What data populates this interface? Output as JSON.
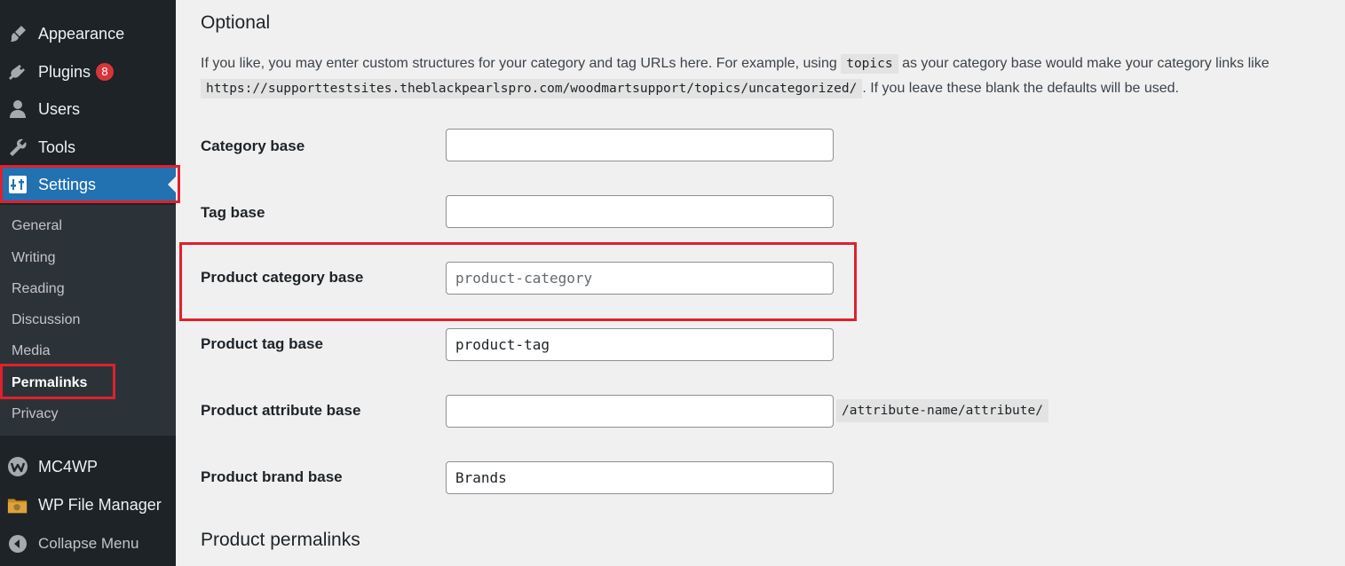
{
  "sidebar": {
    "top_items": [
      {
        "label": "Appearance",
        "icon": "paintbrush-icon"
      },
      {
        "label": "Plugins",
        "icon": "plugins-icon",
        "badge": "8"
      },
      {
        "label": "Users",
        "icon": "users-icon"
      },
      {
        "label": "Tools",
        "icon": "wrench-icon"
      },
      {
        "label": "Settings",
        "icon": "settings-icon",
        "active": true
      }
    ],
    "submenu": [
      "General",
      "Writing",
      "Reading",
      "Discussion",
      "Media",
      "Permalinks",
      "Privacy"
    ],
    "current_submenu": "Permalinks",
    "bottom_items": [
      {
        "label": "MC4WP",
        "icon": "mc4wp-icon"
      },
      {
        "label": "WP File Manager",
        "icon": "folder-icon"
      },
      {
        "label": "Collapse Menu",
        "icon": "collapse-icon"
      }
    ],
    "colors": {
      "background": "#1d2327",
      "submenu": "#2c3338",
      "active": "#2271b1",
      "badge": "#d63638",
      "highlight": "#e0202c"
    }
  },
  "main": {
    "section_title": "Optional",
    "description": {
      "part1": "If you like, you may enter custom structures for your category and tag URLs here. For example, using",
      "code1": "topics",
      "part2": "as your category base would make your category links like",
      "code2": "https://supporttestsites.theblackpearlspro.com/woodmartsupport/topics/uncategorized/",
      "part3": ". If you leave these blank the defaults will be used."
    },
    "fields": [
      {
        "label": "Category base",
        "value": "",
        "placeholder": ""
      },
      {
        "label": "Tag base",
        "value": "",
        "placeholder": ""
      },
      {
        "label": "Product category base",
        "value": "",
        "placeholder": "product-category"
      },
      {
        "label": "Product tag base",
        "value": "product-tag",
        "placeholder": ""
      },
      {
        "label": "Product attribute base",
        "value": "",
        "placeholder": "",
        "suffix": "/attribute-name/attribute/"
      },
      {
        "label": "Product brand base",
        "value": "Brands",
        "placeholder": ""
      }
    ],
    "next_section_title": "Product permalinks"
  }
}
